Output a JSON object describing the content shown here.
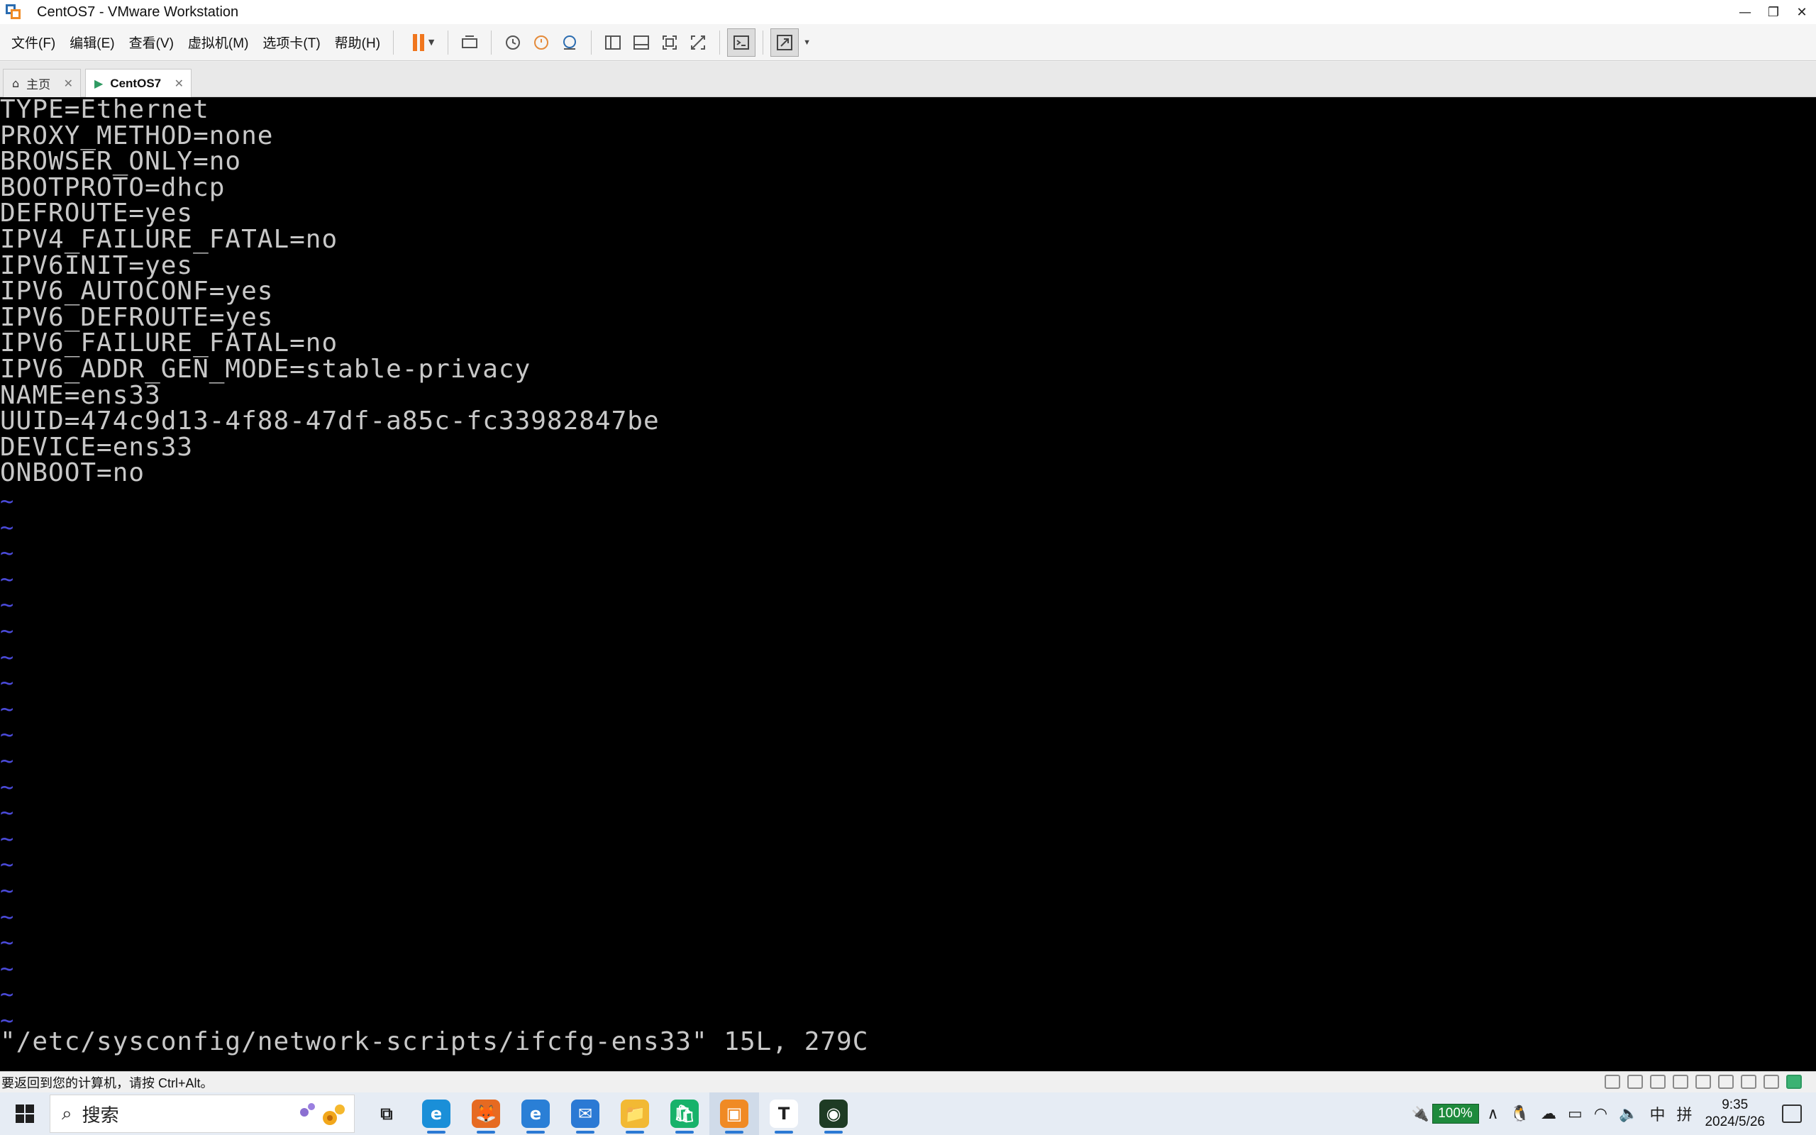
{
  "window": {
    "title": "CentOS7 - VMware Workstation",
    "controls": {
      "minimize": "—",
      "restore": "❐",
      "close": "✕"
    }
  },
  "menu": {
    "items": [
      "文件(F)",
      "编辑(E)",
      "查看(V)",
      "虚拟机(M)",
      "选项卡(T)",
      "帮助(H)"
    ]
  },
  "tabs": [
    {
      "label": "主页",
      "icon": "home-icon"
    },
    {
      "label": "CentOS7",
      "icon": "vm-icon"
    }
  ],
  "console": {
    "lines": [
      "TYPE=Ethernet",
      "PROXY_METHOD=none",
      "BROWSER_ONLY=no",
      "BOOTPROTO=dhcp",
      "DEFROUTE=yes",
      "IPV4_FAILURE_FATAL=no",
      "IPV6INIT=yes",
      "IPV6_AUTOCONF=yes",
      "IPV6_DEFROUTE=yes",
      "IPV6_FAILURE_FATAL=no",
      "IPV6_ADDR_GEN_MODE=stable-privacy",
      "NAME=ens33",
      "UUID=474c9d13-4f88-47df-a85c-fc33982847be",
      "DEVICE=ens33",
      "ONBOOT=no"
    ],
    "tilde": "~",
    "status": "\"/etc/sysconfig/network-scripts/ifcfg-ens33\" 15L, 279C",
    "text_color": "#c8c8c8",
    "tilde_color": "#4a4ad8"
  },
  "hint": "要返回到您的计算机，请按 Ctrl+Alt。",
  "taskbar": {
    "search_text": "搜索",
    "apps": [
      {
        "name": "task-view",
        "glyph": "⧉",
        "color": "#e6ecf4"
      },
      {
        "name": "edge",
        "glyph": "e",
        "color": "#1a8fd8"
      },
      {
        "name": "firefox",
        "glyph": "🦊",
        "color": "#e66a21"
      },
      {
        "name": "ie",
        "glyph": "e",
        "color": "#2a7fd6"
      },
      {
        "name": "mail",
        "glyph": "✉",
        "color": "#2b79d4"
      },
      {
        "name": "explorer",
        "glyph": "📁",
        "color": "#f2b934"
      },
      {
        "name": "store",
        "glyph": "🛍",
        "color": "#17b26a"
      },
      {
        "name": "vmware",
        "glyph": "▣",
        "color": "#f08a24"
      },
      {
        "name": "typora",
        "glyph": "T",
        "color": "#ffffff"
      },
      {
        "name": "app-dark",
        "glyph": "◉",
        "color": "#1e3b24"
      }
    ],
    "battery": "100%",
    "ime": "中",
    "ime2": "拼",
    "time": "9:35",
    "date": "2024/5/26"
  }
}
